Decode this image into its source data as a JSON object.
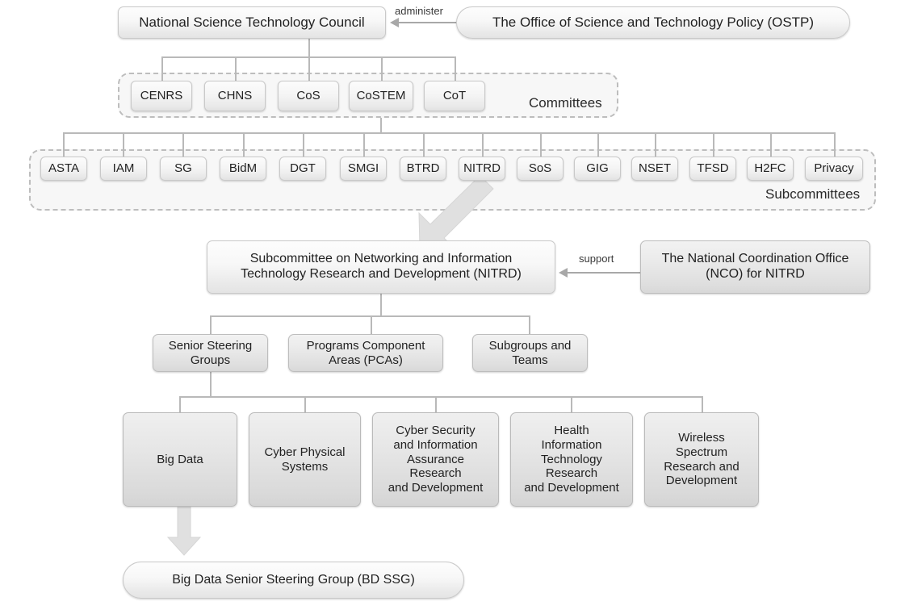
{
  "diagram": {
    "title": "NITRD / NSTC organizational structure",
    "colors": {
      "node_fill": "#f2f2f2",
      "node_border": "#c9c9c9",
      "connector": "#b9b9b9",
      "group_border": "#bdbdbd",
      "block_arrow": "#dcdcdc",
      "text": "#222222"
    }
  },
  "top": {
    "council": "National Science Technology Council",
    "ostp": "The Office of Science and Technology Policy (OSTP)",
    "administer_label": "administer"
  },
  "committees": {
    "group_label": "Committees",
    "items": [
      {
        "label": "CENRS"
      },
      {
        "label": "CHNS"
      },
      {
        "label": "CoS"
      },
      {
        "label": "CoSTEM"
      },
      {
        "label": "CoT"
      }
    ]
  },
  "subcommittees": {
    "group_label": "Subcommittees",
    "items": [
      {
        "label": "ASTA"
      },
      {
        "label": "IAM"
      },
      {
        "label": "SG"
      },
      {
        "label": "BidM"
      },
      {
        "label": "DGT"
      },
      {
        "label": "SMGI"
      },
      {
        "label": "BTRD"
      },
      {
        "label": "NITRD"
      },
      {
        "label": "SoS"
      },
      {
        "label": "GIG"
      },
      {
        "label": "NSET"
      },
      {
        "label": "TFSD"
      },
      {
        "label": "H2FC"
      },
      {
        "label": "Privacy"
      }
    ]
  },
  "nitrd": {
    "title": "Subcommittee on Networking and Information\nTechnology Research and Development (NITRD)",
    "nco": "The National Coordination Office\n(NCO) for NITRD",
    "support_label": "support"
  },
  "tier3": {
    "items": [
      {
        "label": "Senior Steering\nGroups"
      },
      {
        "label": "Programs Component\nAreas (PCAs)"
      },
      {
        "label": "Subgroups and\nTeams"
      }
    ]
  },
  "ssg": {
    "items": [
      {
        "label": "Big Data"
      },
      {
        "label": "Cyber Physical\nSystems"
      },
      {
        "label": "Cyber Security\nand Information\nAssurance\nResearch\nand Development"
      },
      {
        "label": "Health\nInformation\nTechnology\nResearch\nand Development"
      },
      {
        "label": "Wireless\nSpectrum\nResearch and\nDevelopment"
      }
    ]
  },
  "bottom": {
    "bdssg": "Big Data Senior Steering Group (BD SSG)"
  }
}
